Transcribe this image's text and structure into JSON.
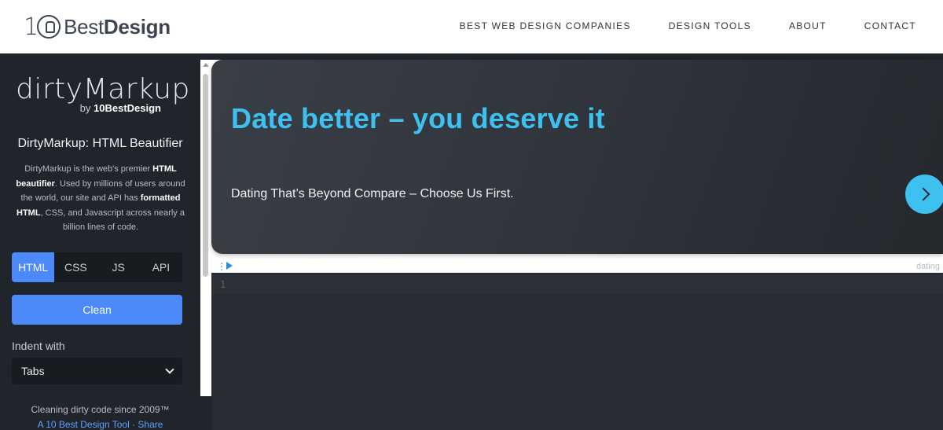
{
  "nav": {
    "brand_prefix": "10",
    "brand_light": "Best",
    "brand_bold": "Design",
    "links": [
      {
        "label": "BEST WEB DESIGN COMPANIES"
      },
      {
        "label": "DESIGN TOOLS"
      },
      {
        "label": "ABOUT"
      },
      {
        "label": "CONTACT"
      }
    ]
  },
  "sidebar": {
    "logo_main": "dirtyMarkup",
    "logo_by_prefix": "by ",
    "logo_by_brand": "10BestDesign",
    "title": "DirtyMarkup: HTML Beautifier",
    "desc_1": "DirtyMarkup is the web's premier ",
    "desc_bold_1": "HTML beautifier",
    "desc_2": ". Used by millions of users around the world, our site and API has ",
    "desc_bold_2": "formatted HTML",
    "desc_3": ", CSS, and Javascript across nearly a billion lines of code.",
    "tabs": [
      {
        "label": "HTML",
        "active": true
      },
      {
        "label": "CSS",
        "active": false
      },
      {
        "label": "JS",
        "active": false
      },
      {
        "label": "API",
        "active": false
      }
    ],
    "clean_label": "Clean",
    "indent_label": "Indent with",
    "indent_value": "Tabs",
    "footer_1": "Cleaning dirty code since 2009™",
    "footer_2": "A 10 Best Design Tool · Share"
  },
  "ad": {
    "title": "Date better – you deserve it",
    "subtitle": "Dating That’s Beyond Compare – Choose Us First.",
    "label": "dating"
  },
  "editor": {
    "line_number": "1"
  },
  "colors": {
    "accent": "#4b8af8",
    "ad_accent": "#3fc1f0",
    "sidebar_bg": "#20242b",
    "editor_bg": "#282c34"
  }
}
